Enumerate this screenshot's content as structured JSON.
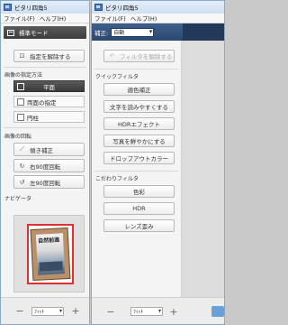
{
  "left_window": {
    "title": "ピタリ四角5",
    "menu": [
      "ファイル(F)",
      "ヘルプ(H)"
    ],
    "mode_header": "標準モード",
    "release_button": "指定を解除する",
    "section_method": "画像の指定方法",
    "method_options": [
      {
        "label": "平面",
        "selected": true
      },
      {
        "label": "両面の指定",
        "selected": false
      },
      {
        "label": "円柱",
        "selected": false
      }
    ],
    "section_rotation": "画像の回転",
    "rotation_buttons": [
      "傾き補正",
      "右90度回転",
      "左90度回転"
    ],
    "section_navigator": "ナビゲータ",
    "navigator_photo_text": "自然前進",
    "zoom_minus": "−",
    "zoom_plus": "+",
    "zoom_value": "ﾌｨｯﾄ"
  },
  "right_window": {
    "title": "ピタリ四角5",
    "menu": [
      "ファイル(F)",
      "ヘルプ(H)"
    ],
    "correction_label": "補正:",
    "correction_value": "自動",
    "release_filter_button": "フィルタを解除する",
    "section_quick": "クイックフィルタ",
    "quick_filters": [
      "適色補正",
      "文字を読みやすくする",
      "HDRエフェクト",
      "写真を鮮やかにする",
      "ドロップアウトカラー"
    ],
    "section_special": "こだわりフィルタ",
    "special_filters": [
      "色彩",
      "HDR",
      "レンズ歪み"
    ],
    "zoom_minus": "−",
    "zoom_plus": "+",
    "zoom_value": "ﾌｨｯﾄ"
  }
}
